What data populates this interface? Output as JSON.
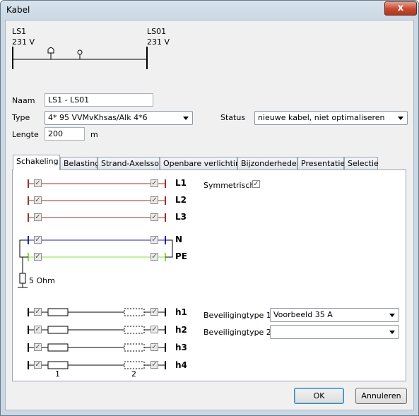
{
  "window": {
    "title": "Kabel",
    "close_label": "x"
  },
  "diagram": {
    "from": {
      "name": "LS1",
      "voltage": "231 V"
    },
    "to": {
      "name": "LS01",
      "voltage": "231 V"
    }
  },
  "form": {
    "naam_label": "Naam",
    "naam_value": "LS1 - LS01",
    "type_label": "Type",
    "type_value": "4* 95 VVMvKhsas/Alk 4*6",
    "status_label": "Status",
    "status_value": "nieuwe kabel, niet optimaliseren",
    "lengte_label": "Lengte",
    "lengte_value": "200",
    "lengte_unit": "m"
  },
  "tabs": [
    "Schakeling",
    "Belasting",
    "Strand-Axelsson",
    "Openbare verlichting",
    "Bijzonderheden",
    "Presentatie",
    "Selectie"
  ],
  "schakeling": {
    "phases": [
      "L1",
      "L2",
      "L3"
    ],
    "neutral": [
      "N",
      "PE"
    ],
    "earth_label": "5 Ohm",
    "symmetrisch_label": "Symmetrisch",
    "h_rows": [
      "h1",
      "h2",
      "h3",
      "h4"
    ],
    "fuse_labels": [
      "1",
      "2"
    ],
    "beveiliging1_label": "Beveiligingtype 1",
    "beveiliging1_value": "Voorbeeld 35 A",
    "beveiliging2_label": "Beveiligingtype 2",
    "beveiliging2_value": ""
  },
  "buttons": {
    "ok": "OK",
    "cancel": "Annuleren"
  },
  "colors": {
    "phase": "#9b3030",
    "neutral": "#2020c0",
    "pe": "#80e040"
  }
}
